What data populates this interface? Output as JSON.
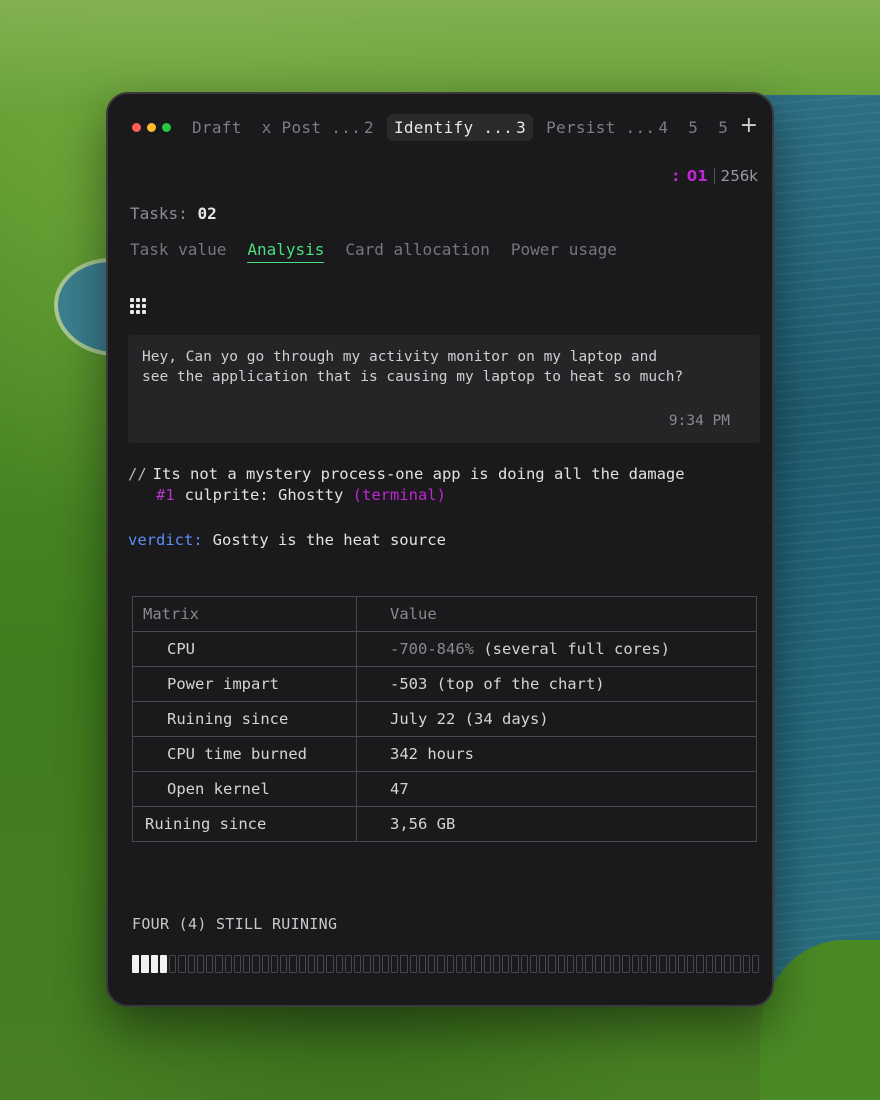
{
  "window": {
    "tabs": [
      {
        "label": "Draft",
        "number": ""
      },
      {
        "label": "x Post ...",
        "number": "2"
      },
      {
        "label": "Identify ...",
        "number": "3"
      },
      {
        "label": "Persist ...",
        "number": "4"
      },
      {
        "label": "5",
        "number": ""
      },
      {
        "label": "5",
        "number": ""
      }
    ],
    "active_tab_index": 2,
    "new_tab": "+"
  },
  "status": {
    "prefix": ":",
    "count": "01",
    "context": "256k"
  },
  "tasks": {
    "label": "Tasks:",
    "value": "02"
  },
  "subtabs": [
    "Task value",
    "Analysis",
    "Card allocation",
    "Power usage"
  ],
  "active_subtab": "Analysis",
  "message": {
    "line1": "Hey, Can yo go through my activity monitor on my laptop and",
    "line2": "see the application that is causing my laptop to heat so much?",
    "time": "9:34 PM"
  },
  "reply": {
    "prefix": "//",
    "text": "Its not a mystery process-one app is doing all the damage",
    "rank": "#1",
    "culprit_label": "culprite: Ghostty",
    "culprit_tag": "(terminal)"
  },
  "verdict": {
    "key": "verdict:",
    "value": "Gostty is the heat source"
  },
  "matrix": {
    "headers": [
      "Matrix",
      "Value"
    ],
    "rows": [
      {
        "key": "CPU",
        "value_dim": "-700-846%",
        "value": "(several full cores)"
      },
      {
        "key": "Power impart",
        "value_dim": "",
        "value": "-503 (top of the chart)"
      },
      {
        "key": "Ruining since",
        "value_dim": "",
        "value": "July 22 (34 days)"
      },
      {
        "key": "CPU time burned",
        "value_dim": "",
        "value": "342 hours"
      },
      {
        "key": "Open kernel",
        "value_dim": "",
        "value": "47"
      },
      {
        "key": "Ruining since",
        "value_dim": "",
        "value": "3,56 GB"
      }
    ]
  },
  "footer": {
    "label": "FOUR (4) STILL RUINING",
    "progress_fraction": 0.06
  },
  "colors": {
    "accent_green": "#4ade80",
    "accent_magenta": "#c026d3",
    "accent_blue": "#5b8ef5",
    "window_bg": "#1a191b"
  }
}
